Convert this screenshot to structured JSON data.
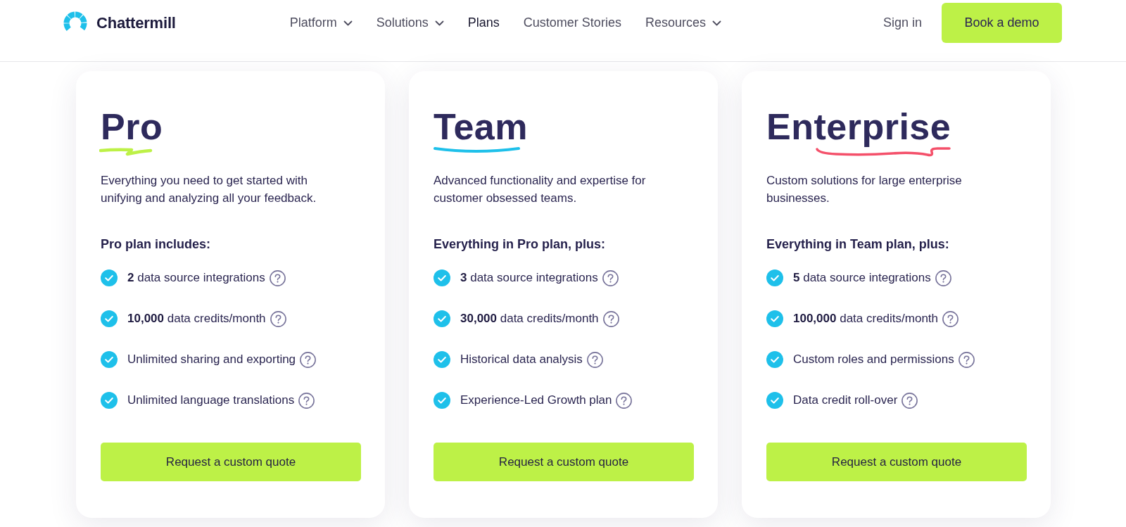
{
  "header": {
    "brand": "Chattermill",
    "nav": [
      {
        "label": "Platform",
        "dropdown": true,
        "selected": false
      },
      {
        "label": "Solutions",
        "dropdown": true,
        "selected": false
      },
      {
        "label": "Plans",
        "dropdown": false,
        "selected": true
      },
      {
        "label": "Customer Stories",
        "dropdown": false,
        "selected": false
      },
      {
        "label": "Resources",
        "dropdown": true,
        "selected": false
      }
    ],
    "sign_in": "Sign in",
    "cta": "Book a demo"
  },
  "plans": [
    {
      "name": "Pro",
      "color": "#bdf147",
      "description": "Everything you need to get started with unifying and analyzing all your feedback.",
      "includes_heading": "Pro plan includes:",
      "features": [
        "**2** data source integrations",
        "**10,000** data credits/month",
        "Unlimited sharing and exporting",
        "Unlimited language translations"
      ],
      "button": "Request a custom quote"
    },
    {
      "name": "Team",
      "color": "#1ec0ea",
      "description": "Advanced functionality and expertise for customer obsessed teams.",
      "includes_heading": "Everything in Pro plan, plus:",
      "features": [
        "**3** data source integrations",
        "**30,000** data credits/month",
        "Historical data analysis",
        "Experience-Led Growth plan"
      ],
      "button": "Request a custom quote"
    },
    {
      "name": "Enterprise",
      "color": "#f4506a",
      "description": "Custom solutions for large enterprise businesses.",
      "includes_heading": "Everything in Team plan, plus:",
      "features": [
        "**5** data source integrations",
        "**100,000** data credits/month",
        "Custom roles and permissions",
        "Data credit roll-over"
      ],
      "button": "Request a custom quote"
    }
  ]
}
